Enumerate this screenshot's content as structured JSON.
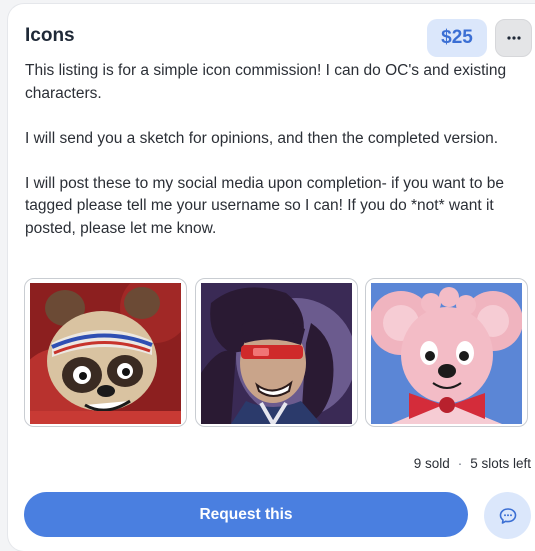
{
  "listing": {
    "title": "Icons",
    "price": "$25",
    "more_icon": "ellipsis-icon",
    "description": [
      "This listing is for a simple icon commission! I can do OC's and existing characters.",
      "I will send you a sketch for opinions, and then the completed version.",
      "I will post these to my social media upon completion- if you want to be tagged please tell me your username so I can! If you do *not* want it posted, please let me know."
    ],
    "stats": {
      "sold": "9 sold",
      "separator": "·",
      "slots": "5 slots left"
    },
    "request_label": "Request this",
    "chat_icon": "chat-bubble-icon"
  },
  "colors": {
    "accent": "#4a7fe0",
    "price_bg": "#dbe7fb",
    "price_text": "#3b6fd4"
  }
}
